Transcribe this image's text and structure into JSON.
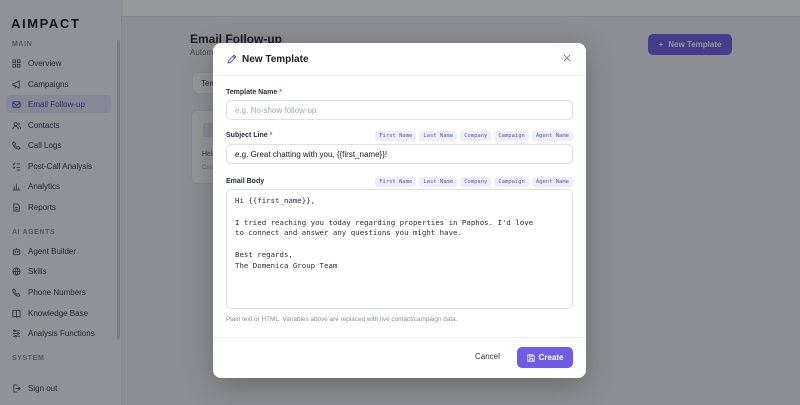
{
  "sidebar": {
    "logo": "AIMPACT",
    "sections": {
      "main": "MAIN",
      "ai_agents": "AI AGENTS",
      "system": "SYSTEM"
    },
    "main_items": [
      {
        "label": "Overview",
        "icon": "grid-icon"
      },
      {
        "label": "Campaigns",
        "icon": "megaphone-icon"
      },
      {
        "label": "Email Follow-up",
        "icon": "mail-icon",
        "active": true
      },
      {
        "label": "Contacts",
        "icon": "users-icon"
      },
      {
        "label": "Call Logs",
        "icon": "phone-icon"
      },
      {
        "label": "Post-Call Analysis",
        "icon": "checklist-icon"
      },
      {
        "label": "Analytics",
        "icon": "bar-chart-icon"
      },
      {
        "label": "Reports",
        "icon": "file-icon"
      }
    ],
    "agent_items": [
      {
        "label": "Agent Builder",
        "icon": "bot-icon"
      },
      {
        "label": "Skills",
        "icon": "globe-icon"
      },
      {
        "label": "Phone Numbers",
        "icon": "phone-icon"
      },
      {
        "label": "Knowledge Base",
        "icon": "book-icon"
      },
      {
        "label": "Analysis Functions",
        "icon": "sliders-icon"
      }
    ],
    "sign_out": "Sign out"
  },
  "main": {
    "title": "Email Follow-up",
    "subtitle": "Autom",
    "new_template_button": "New Template",
    "tab_partial": "Tem",
    "card_text": "Hel",
    "card_sub": "Crea"
  },
  "modal": {
    "title": "New Template",
    "template_name": {
      "label": "Template Name",
      "required_mark": "*",
      "placeholder": "e.g. No-show follow-up"
    },
    "subject_line": {
      "label": "Subject Line",
      "required_mark": "*",
      "value": "e.g. Great chatting with you, {{first_name}}!",
      "variables": [
        "First Name",
        "Last Name",
        "Company",
        "Campaign",
        "Agent Name"
      ]
    },
    "email_body": {
      "label": "Email Body",
      "variables": [
        "First Name",
        "Last Name",
        "Company",
        "Campaign",
        "Agent Name"
      ],
      "value": "Hi {{first_name}},\n\nI tried reaching you today regarding properties in Paphos. I'd love\nto connect and answer any questions you might have.\n\nBest regards,\nThe Domenica Group Team"
    },
    "help_text": "Plain text or HTML. Variables above are replaced with live contact/campaign data.",
    "cancel_label": "Cancel",
    "create_label": "Create"
  },
  "colors": {
    "accent": "#6f5ce6",
    "required": "#e5484d",
    "chip_bg": "#eeeefb",
    "chip_text": "#5a54b8"
  }
}
